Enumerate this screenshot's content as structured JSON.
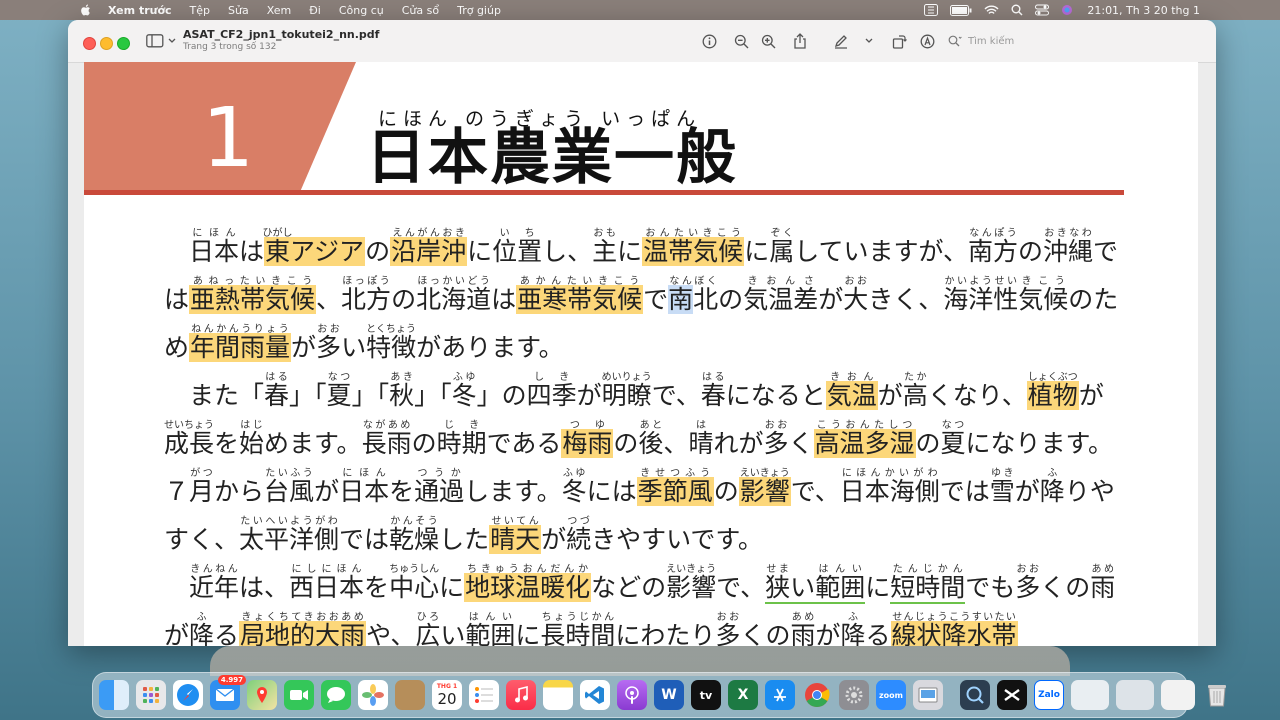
{
  "menubar": {
    "app_name": "Xem trước",
    "items": [
      "Tệp",
      "Sửa",
      "Xem",
      "Đi",
      "Công cụ",
      "Cửa sổ",
      "Trợ giúp"
    ],
    "clock": "21:01, Th 3 20 thg 1"
  },
  "window": {
    "title": "ASAT_CF2_jpn1_tokutei2_nn.pdf",
    "subtitle": "Trang 3 trong số 132",
    "search_placeholder": "Tìm kiếm"
  },
  "document": {
    "chapter_number": "1",
    "heading_ruby": "にほん のうぎょう いっぱん",
    "heading": "日本農業一般"
  },
  "dock": {
    "mail_badge": "4.997",
    "calendar_month": "THG 1",
    "calendar_day": "20",
    "zoom_label": "zoom",
    "zalo_label": "Zalo",
    "word_label": "W",
    "excel_label": "X",
    "tv_label": "tv"
  },
  "colors": {
    "highlight": "#fcd77a",
    "chapter_band": "#d97e66",
    "rule": "#c9493a"
  }
}
